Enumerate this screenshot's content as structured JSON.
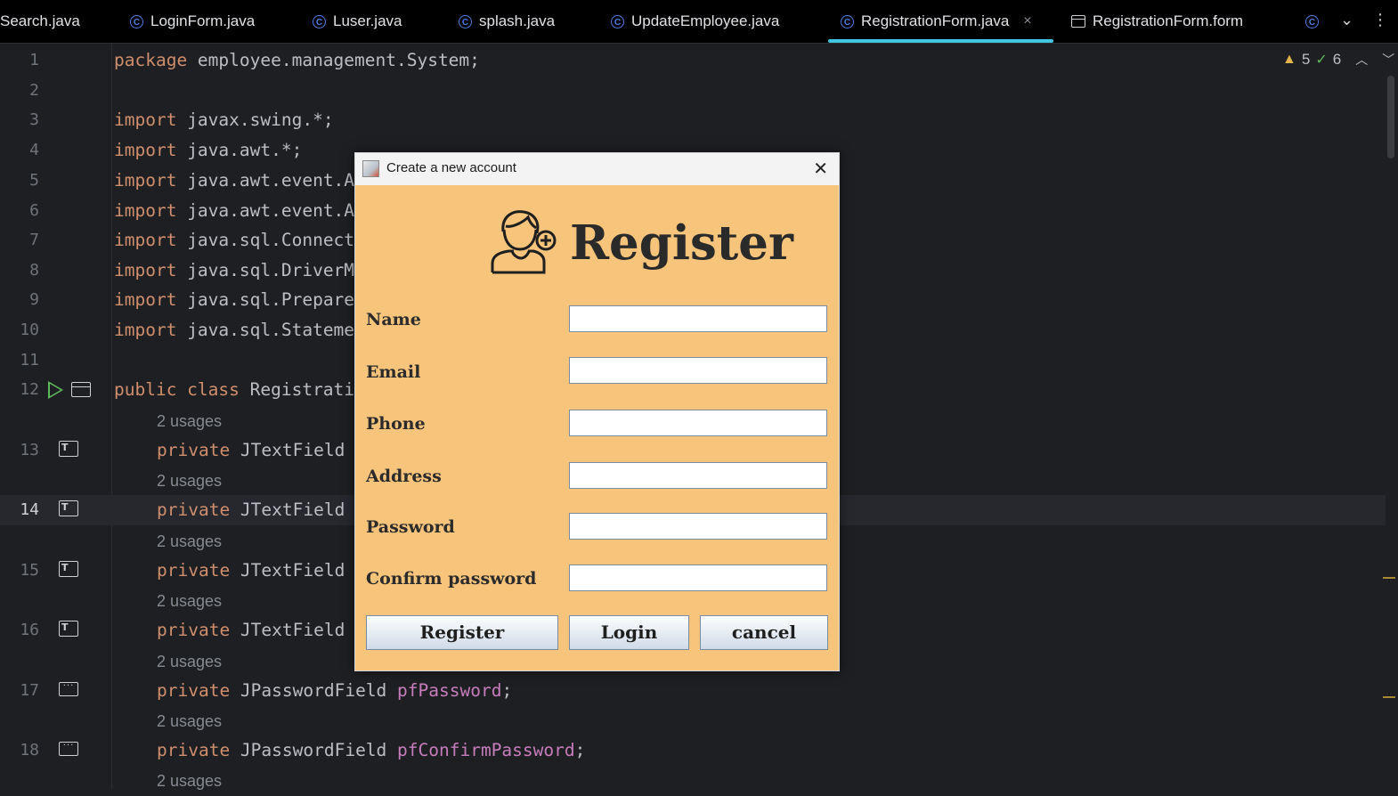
{
  "tabs": [
    {
      "label": "Search.java",
      "icon": "class-icon"
    },
    {
      "label": "LoginForm.java",
      "icon": "class-icon"
    },
    {
      "label": "Luser.java",
      "icon": "class-icon"
    },
    {
      "label": "splash.java",
      "icon": "class-icon"
    },
    {
      "label": "UpdateEmployee.java",
      "icon": "class-icon"
    },
    {
      "label": "RegistrationForm.java",
      "icon": "class-icon",
      "active": true,
      "close": "×"
    },
    {
      "label": "RegistrationForm.form",
      "icon": "form-icon"
    }
  ],
  "tab_controls": {
    "chevron": "⌄",
    "more": "⋮"
  },
  "inspections": {
    "warnings": "5",
    "ok": "6"
  },
  "lines": [
    {
      "n": "1",
      "kw": "package",
      "text": " employee.management.System;"
    },
    {
      "n": "2"
    },
    {
      "n": "3",
      "kw": "import",
      "text": " javax.swing.*;"
    },
    {
      "n": "4",
      "kw": "import",
      "text": " java.awt.*;"
    },
    {
      "n": "5",
      "kw": "import",
      "text": " java.awt.event.A"
    },
    {
      "n": "6",
      "kw": "import",
      "text": " java.awt.event.A"
    },
    {
      "n": "7",
      "kw": "import",
      "text": " java.sql.Connect"
    },
    {
      "n": "8",
      "kw": "import",
      "text": " java.sql.DriverM"
    },
    {
      "n": "9",
      "kw": "import",
      "text": " java.sql.Prepare"
    },
    {
      "n": "10",
      "kw": "import",
      "text": " java.sql.Stateme"
    },
    {
      "n": "11"
    },
    {
      "n": "12",
      "kw": "public class",
      "text": " Registrati"
    },
    {
      "n": "13",
      "kw": "private",
      "text": " JTextField"
    },
    {
      "n": "14",
      "kw": "private",
      "text": " JTextField"
    },
    {
      "n": "15",
      "kw": "private",
      "text": " JTextField"
    },
    {
      "n": "16",
      "kw": "private",
      "text": " JTextField"
    },
    {
      "n": "17",
      "kw": "private",
      "text": " JPasswordField ",
      "field": "pfPassword",
      "end": ";"
    },
    {
      "n": "18",
      "kw": "private",
      "text": " JPasswordField ",
      "field": "pfConfirmPassword",
      "end": ";"
    }
  ],
  "usage_label": "2 usages",
  "dialog": {
    "title": "Create a new account",
    "close": "✕",
    "heading": "Register",
    "fields": [
      {
        "label": "Name",
        "value": ""
      },
      {
        "label": "Email",
        "value": ""
      },
      {
        "label": "Phone",
        "value": ""
      },
      {
        "label": "Address",
        "value": ""
      },
      {
        "label": "Password",
        "value": ""
      },
      {
        "label": "Confirm password",
        "value": ""
      }
    ],
    "buttons": {
      "register": "Register",
      "login": "Login",
      "cancel": "cancel"
    }
  },
  "colors": {
    "accent_tab": "#3fc6e0",
    "keyword": "#cf8e6d",
    "field": "#c77dbb",
    "dialog_bg": "#f7c47c"
  }
}
